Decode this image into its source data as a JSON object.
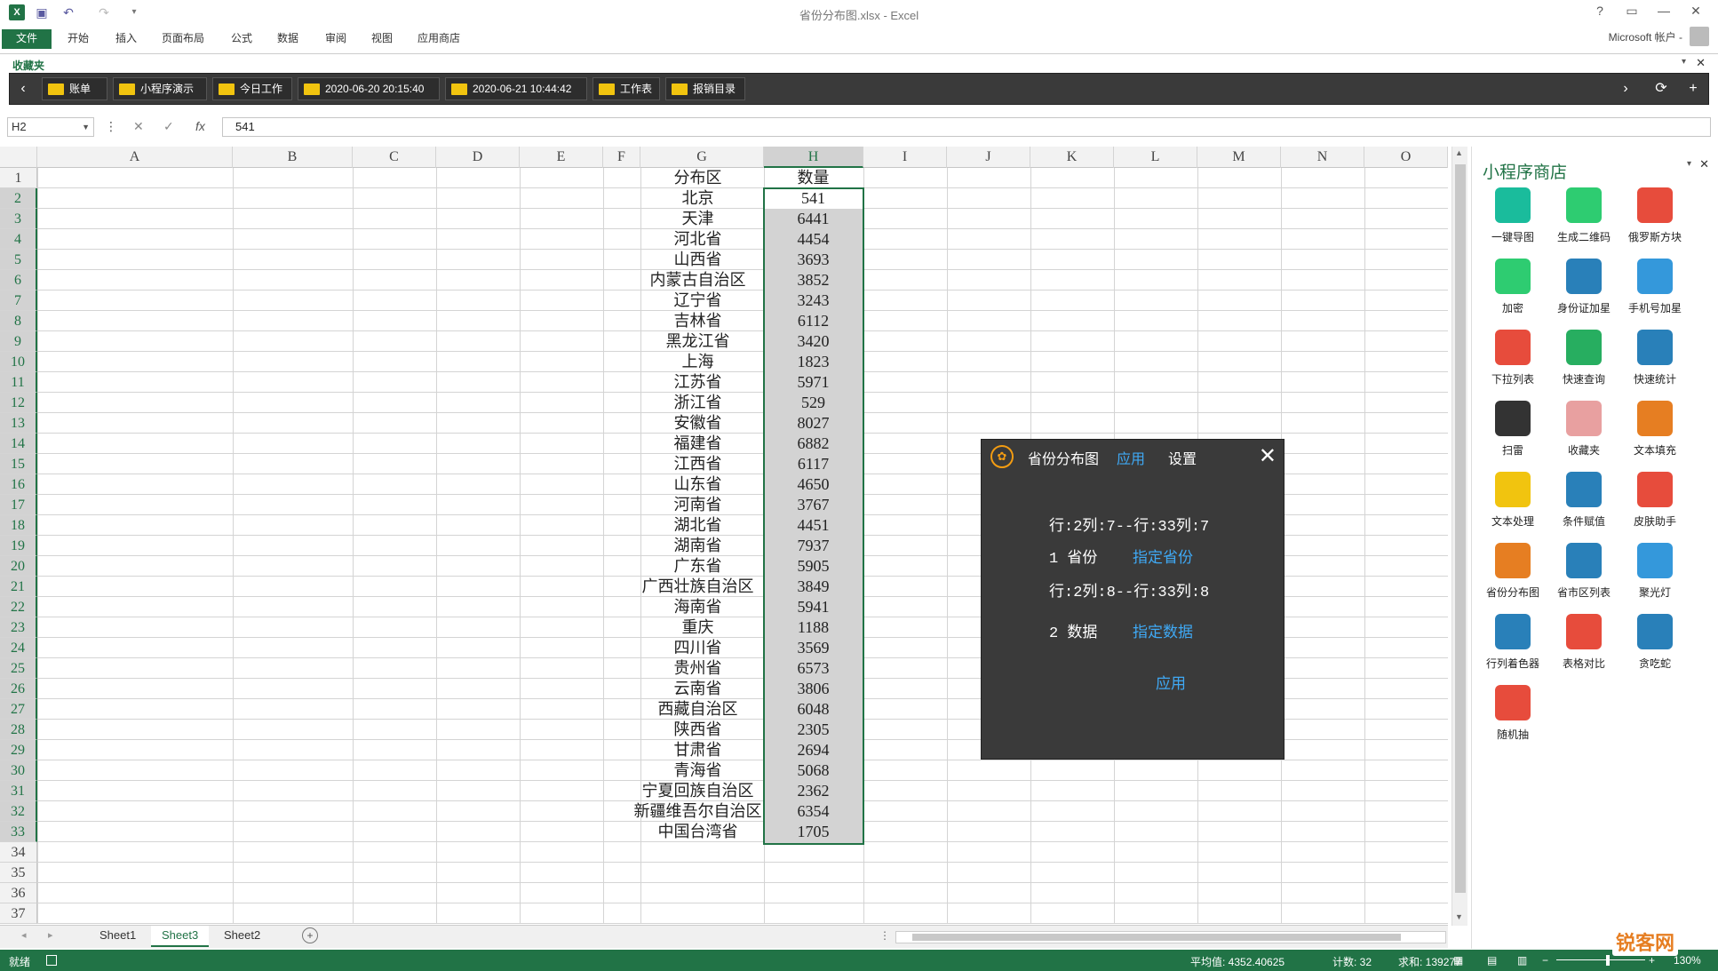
{
  "window": {
    "title": "省份分布图.xlsx - Excel"
  },
  "ribbon": {
    "tabs": [
      "文件",
      "开始",
      "插入",
      "页面布局",
      "公式",
      "数据",
      "审阅",
      "视图",
      "应用商店"
    ],
    "account": "Microsoft 帐户 -"
  },
  "favorites": {
    "label": "收藏夹",
    "items": [
      "账单",
      "小程序演示",
      "今日工作",
      "2020-06-20 20:15:40",
      "2020-06-21 10:44:42",
      "工作表",
      "报销目录"
    ]
  },
  "formula_bar": {
    "name_box": "H2",
    "value": "541"
  },
  "columns": [
    "A",
    "B",
    "C",
    "D",
    "E",
    "F",
    "G",
    "H",
    "I",
    "J",
    "K",
    "L",
    "M",
    "N",
    "O"
  ],
  "rows": [
    "1",
    "2",
    "3",
    "4",
    "5",
    "6",
    "7",
    "8",
    "9",
    "10",
    "11",
    "12",
    "13",
    "14",
    "15",
    "16",
    "17",
    "18",
    "19",
    "20",
    "21",
    "22",
    "23",
    "24",
    "25",
    "26",
    "27",
    "28",
    "29",
    "30",
    "31",
    "32",
    "33",
    "34",
    "35",
    "36",
    "37"
  ],
  "header": {
    "g": "分布区",
    "h": "数量"
  },
  "data": [
    [
      "北京",
      "541"
    ],
    [
      "天津",
      "6441"
    ],
    [
      "河北省",
      "4454"
    ],
    [
      "山西省",
      "3693"
    ],
    [
      "内蒙古自治区",
      "3852"
    ],
    [
      "辽宁省",
      "3243"
    ],
    [
      "吉林省",
      "6112"
    ],
    [
      "黑龙江省",
      "3420"
    ],
    [
      "上海",
      "1823"
    ],
    [
      "江苏省",
      "5971"
    ],
    [
      "浙江省",
      "529"
    ],
    [
      "安徽省",
      "8027"
    ],
    [
      "福建省",
      "6882"
    ],
    [
      "江西省",
      "6117"
    ],
    [
      "山东省",
      "4650"
    ],
    [
      "河南省",
      "3767"
    ],
    [
      "湖北省",
      "4451"
    ],
    [
      "湖南省",
      "7937"
    ],
    [
      "广东省",
      "5905"
    ],
    [
      "广西壮族自治区",
      "3849"
    ],
    [
      "海南省",
      "5941"
    ],
    [
      "重庆",
      "1188"
    ],
    [
      "四川省",
      "3569"
    ],
    [
      "贵州省",
      "6573"
    ],
    [
      "云南省",
      "3806"
    ],
    [
      "西藏自治区",
      "6048"
    ],
    [
      "陕西省",
      "2305"
    ],
    [
      "甘肃省",
      "2694"
    ],
    [
      "青海省",
      "5068"
    ],
    [
      "宁夏回族自治区",
      "2362"
    ],
    [
      "新疆维吾尔自治区",
      "6354"
    ],
    [
      "中国台湾省",
      "1705"
    ]
  ],
  "sheets": {
    "tabs": [
      "Sheet1",
      "Sheet3",
      "Sheet2"
    ],
    "active": "Sheet3"
  },
  "status": {
    "mode": "就绪",
    "average": "平均值: 4352.40625",
    "count": "计数: 32",
    "sum": "求和: 139277",
    "zoom": "130%"
  },
  "panel": {
    "title": "小程序商店",
    "apps": [
      {
        "label": "一键导图",
        "icon": "image-export-icon",
        "color": "#1abc9c"
      },
      {
        "label": "生成二维码",
        "icon": "qrcode-icon",
        "color": "#2ecc71"
      },
      {
        "label": "俄罗斯方块",
        "icon": "cube-icon",
        "color": "#e74c3c"
      },
      {
        "label": "加密",
        "icon": "lock-icon",
        "color": "#2ecc71"
      },
      {
        "label": "身份证加星",
        "icon": "id-card-icon",
        "color": "#2980b9"
      },
      {
        "label": "手机号加星",
        "icon": "phone-icon",
        "color": "#3498db"
      },
      {
        "label": "下拉列表",
        "icon": "dropdown-icon",
        "color": "#e74c3c"
      },
      {
        "label": "快速查询",
        "icon": "search-icon",
        "color": "#27ae60"
      },
      {
        "label": "快速统计",
        "icon": "bar-chart-icon",
        "color": "#2980b9"
      },
      {
        "label": "扫雷",
        "icon": "mine-icon",
        "color": "#333333"
      },
      {
        "label": "收藏夹",
        "icon": "favorite-folder-icon",
        "color": "#e8a0a0"
      },
      {
        "label": "文本填充",
        "icon": "text-fill-icon",
        "color": "#e67e22"
      },
      {
        "label": "文本处理",
        "icon": "text-process-icon",
        "color": "#f1c40f"
      },
      {
        "label": "条件赋值",
        "icon": "if-icon",
        "color": "#2980b9"
      },
      {
        "label": "皮肤助手",
        "icon": "shirt-icon",
        "color": "#e74c3c"
      },
      {
        "label": "省份分布图",
        "icon": "china-map-icon",
        "color": "#e67e22"
      },
      {
        "label": "省市区列表",
        "icon": "location-icon",
        "color": "#2980b9"
      },
      {
        "label": "聚光灯",
        "icon": "bulb-icon",
        "color": "#3498db"
      },
      {
        "label": "行列着色器",
        "icon": "paint-bucket-icon",
        "color": "#2980b9"
      },
      {
        "label": "表格对比",
        "icon": "compare-icon",
        "color": "#e74c3c"
      },
      {
        "label": "贪吃蛇",
        "icon": "snake-icon",
        "color": "#2980b9"
      },
      {
        "label": "随机抽",
        "icon": "wheel-icon",
        "color": "#e74c3c"
      }
    ]
  },
  "dialog": {
    "title": "省份分布图",
    "tab_apply": "应用",
    "tab_settings": "设置",
    "range1": "行:2列:7--行:33列:7",
    "label1": "1 省份",
    "btn1": "指定省份",
    "range2": "行:2列:8--行:33列:8",
    "label2": "2 数据",
    "btn2": "指定数据",
    "apply": "应用"
  },
  "watermark": "锐客网"
}
